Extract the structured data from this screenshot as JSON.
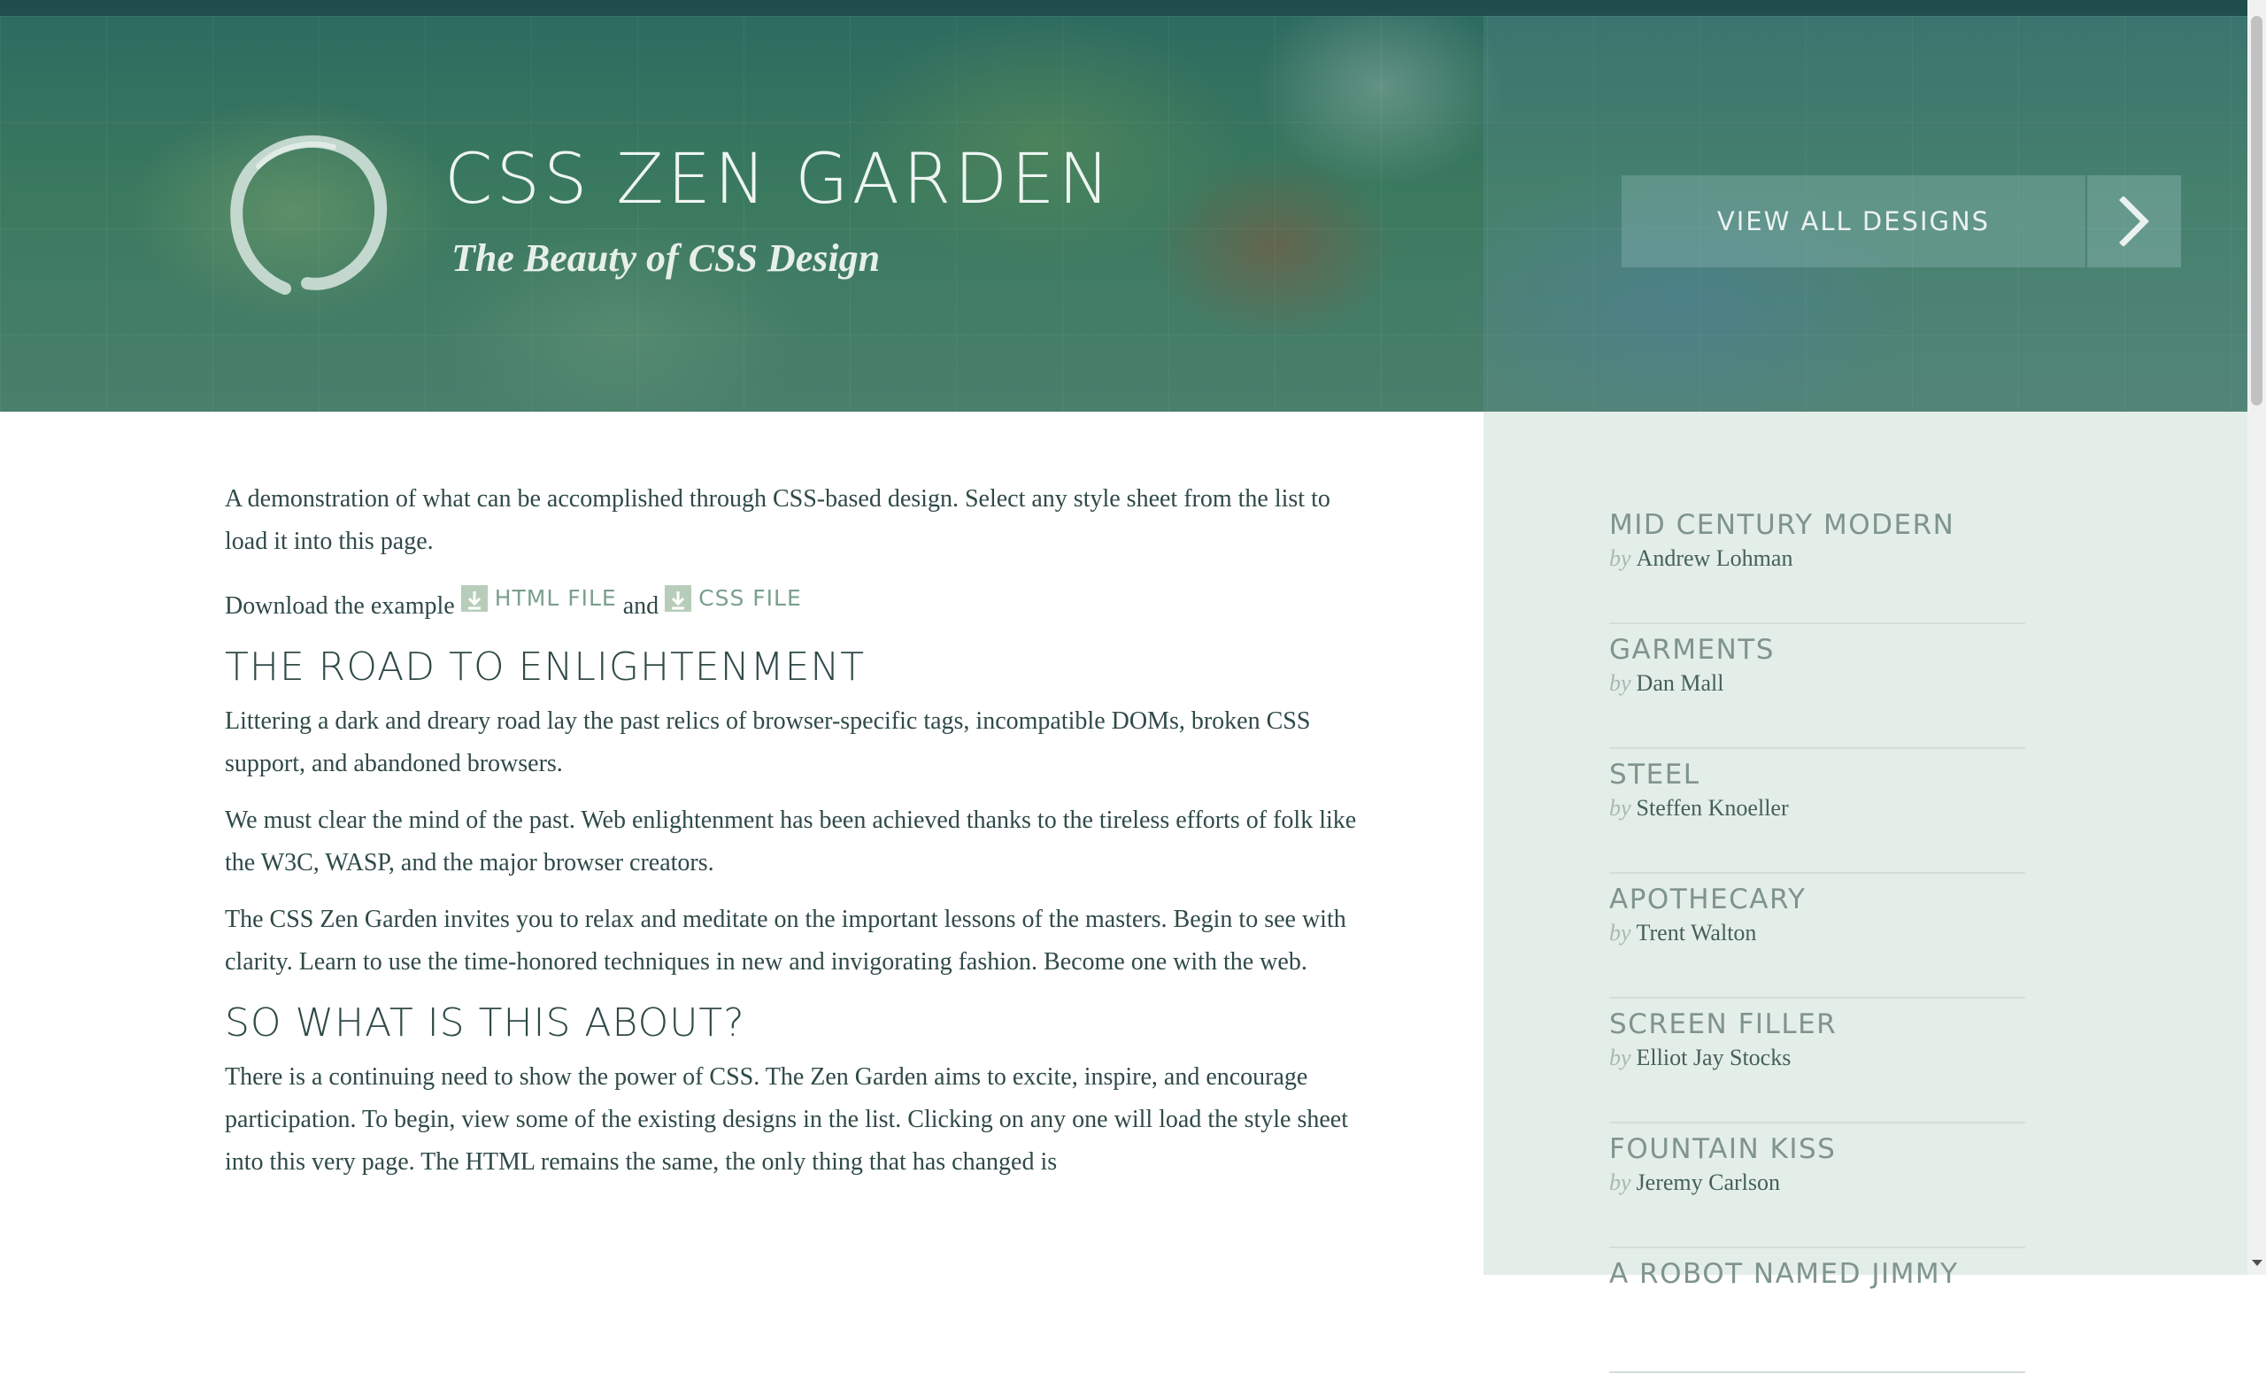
{
  "header": {
    "title": "CSS ZEN GARDEN",
    "tagline": "The Beauty of CSS Design",
    "view_all_label": "VIEW ALL DESIGNS"
  },
  "intro": {
    "text": "A demonstration of what can be accomplished through CSS-based design. Select any style sheet from the list to load it into this page.",
    "download_prefix": "Download the example",
    "html_file_label": "HTML FILE",
    "and": "and",
    "css_file_label": "CSS FILE"
  },
  "sections": [
    {
      "heading": "THE ROAD TO ENLIGHTENMENT",
      "paragraphs": [
        "Littering a dark and dreary road lay the past relics of browser-specific tags, incompatible DOMs, broken CSS support, and abandoned browsers.",
        "We must clear the mind of the past. Web enlightenment has been achieved thanks to the tireless efforts of folk like the W3C, WASP, and the major browser creators.",
        "The CSS Zen Garden invites you to relax and meditate on the important lessons of the masters. Begin to see with clarity. Learn to use the time-honored techniques in new and invigorating fashion. Become one with the web."
      ]
    },
    {
      "heading": "SO WHAT IS THIS ABOUT?",
      "paragraphs": [
        "There is a continuing need to show the power of CSS. The Zen Garden aims to excite, inspire, and encourage participation. To begin, view some of the existing designs in the list. Clicking on any one will load the style sheet into this very page. The HTML remains the same, the only thing that has changed is"
      ]
    }
  ],
  "sidebar": {
    "by_label": "by",
    "designs": [
      {
        "name": "MID CENTURY MODERN",
        "author": "Andrew Lohman"
      },
      {
        "name": "GARMENTS",
        "author": "Dan Mall"
      },
      {
        "name": "STEEL",
        "author": "Steffen Knoeller"
      },
      {
        "name": "APOTHECARY",
        "author": "Trent Walton"
      },
      {
        "name": "SCREEN FILLER",
        "author": "Elliot Jay Stocks"
      },
      {
        "name": "FOUNTAIN KISS",
        "author": "Jeremy Carlson"
      },
      {
        "name": "A ROBOT NAMED JIMMY",
        "author": ""
      }
    ]
  },
  "icons": {
    "logo": "enso-circle-logo",
    "view_all_arrow": "chevron-right-icon",
    "download": "download-icon"
  }
}
